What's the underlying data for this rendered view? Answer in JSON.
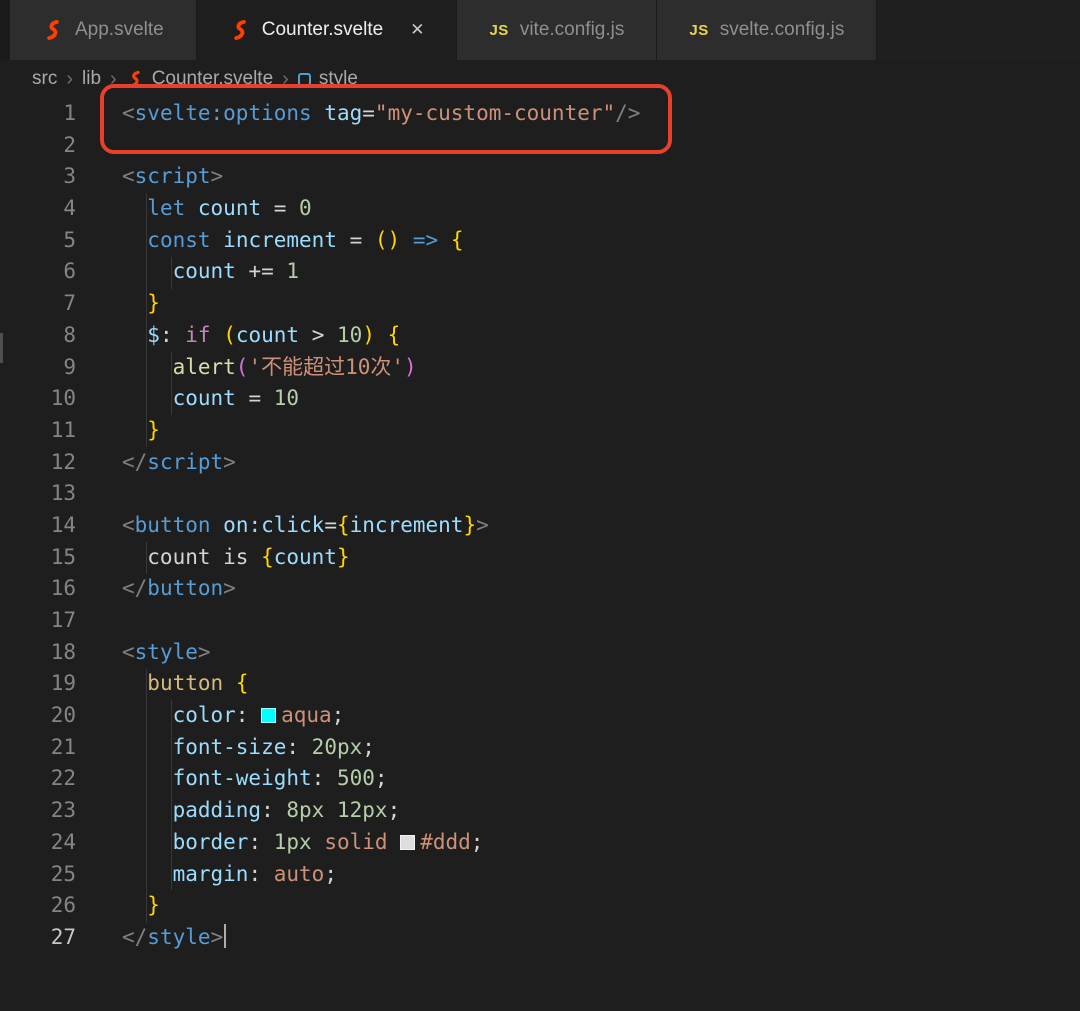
{
  "theme": {
    "editor_bg": "#1e1e1e",
    "tabstrip_bg": "#1f1f1f",
    "tab_inactive_bg": "#2d2d2d",
    "tab_active_bg": "#1e1e1e",
    "tab_inactive_fg": "#8f8f8f",
    "tab_active_fg": "#eeeeee",
    "breadcrumb_fg": "#a9a9a9",
    "line_number_fg": "#858585",
    "line_number_active_fg": "#c6c6c6",
    "svelte_orange": "#ff3e00",
    "js_yellow": "#e8d44d",
    "annotation_red": "#e8402a",
    "tok_tag": "#569cd6",
    "tok_attr": "#9cdcfe",
    "tok_string": "#ce9178",
    "tok_keyword": "#569cd6",
    "tok_control": "#c586c0",
    "tok_variable": "#9cdcfe",
    "tok_number": "#b5cea8",
    "tok_function": "#dcdcaa",
    "tok_punct": "#808080",
    "tok_plain": "#d4d4d4",
    "tok_bracket1": "#ffd700",
    "tok_bracket2": "#da70d6",
    "tok_css_selector": "#d7ba7d"
  },
  "icons": {
    "close": "✕",
    "js_label": "JS"
  },
  "tabs": [
    {
      "label": "App.svelte",
      "icon": "svelte",
      "active": false
    },
    {
      "label": "Counter.svelte",
      "icon": "svelte",
      "active": true
    },
    {
      "label": "vite.config.js",
      "icon": "js",
      "active": false
    },
    {
      "label": "svelte.config.js",
      "icon": "js",
      "active": false
    }
  ],
  "breadcrumb": {
    "separator": "›",
    "items": [
      {
        "label": "src"
      },
      {
        "label": "lib"
      },
      {
        "label": "Counter.svelte",
        "icon": "svelte"
      },
      {
        "label": "style",
        "icon": "symbol"
      }
    ]
  },
  "annotation": {
    "border_color": "#e8402a"
  },
  "editor": {
    "cursor_line": 27,
    "lines": [
      {
        "num": 1,
        "tokens": [
          [
            "p",
            "<"
          ],
          [
            "t",
            "svelte:options"
          ],
          [
            "o",
            " "
          ],
          [
            "a",
            "tag"
          ],
          [
            "o",
            "="
          ],
          [
            "s",
            "\"my-custom-counter\""
          ],
          [
            "p",
            "/>"
          ]
        ]
      },
      {
        "num": 2,
        "tokens": []
      },
      {
        "num": 3,
        "tokens": [
          [
            "p",
            "<"
          ],
          [
            "t",
            "script"
          ],
          [
            "p",
            ">"
          ]
        ]
      },
      {
        "num": 4,
        "tokens": [
          [
            "o",
            "  "
          ],
          [
            "k",
            "let"
          ],
          [
            "o",
            " "
          ],
          [
            "v",
            "count"
          ],
          [
            "o",
            " = "
          ],
          [
            "n",
            "0"
          ]
        ]
      },
      {
        "num": 5,
        "tokens": [
          [
            "o",
            "  "
          ],
          [
            "k",
            "const"
          ],
          [
            "o",
            " "
          ],
          [
            "v",
            "increment"
          ],
          [
            "o",
            " = "
          ],
          [
            "b1",
            "()"
          ],
          [
            "o",
            " "
          ],
          [
            "k",
            "=>"
          ],
          [
            "o",
            " "
          ],
          [
            "b1",
            "{"
          ]
        ]
      },
      {
        "num": 6,
        "tokens": [
          [
            "o",
            "    "
          ],
          [
            "v",
            "count"
          ],
          [
            "o",
            " += "
          ],
          [
            "n",
            "1"
          ]
        ]
      },
      {
        "num": 7,
        "tokens": [
          [
            "o",
            "  "
          ],
          [
            "b1",
            "}"
          ]
        ]
      },
      {
        "num": 8,
        "tokens": [
          [
            "o",
            "  "
          ],
          [
            "v",
            "$"
          ],
          [
            "o",
            ": "
          ],
          [
            "c",
            "if"
          ],
          [
            "o",
            " "
          ],
          [
            "b1",
            "("
          ],
          [
            "v",
            "count"
          ],
          [
            "o",
            " > "
          ],
          [
            "n",
            "10"
          ],
          [
            "b1",
            ")"
          ],
          [
            "o",
            " "
          ],
          [
            "b1",
            "{"
          ]
        ]
      },
      {
        "num": 9,
        "tokens": [
          [
            "o",
            "    "
          ],
          [
            "f",
            "alert"
          ],
          [
            "b2",
            "("
          ],
          [
            "s",
            "'不能超过10次'"
          ],
          [
            "b2",
            ")"
          ]
        ]
      },
      {
        "num": 10,
        "tokens": [
          [
            "o",
            "    "
          ],
          [
            "v",
            "count"
          ],
          [
            "o",
            " = "
          ],
          [
            "n",
            "10"
          ]
        ]
      },
      {
        "num": 11,
        "tokens": [
          [
            "o",
            "  "
          ],
          [
            "b1",
            "}"
          ]
        ]
      },
      {
        "num": 12,
        "tokens": [
          [
            "p",
            "</"
          ],
          [
            "t",
            "script"
          ],
          [
            "p",
            ">"
          ]
        ]
      },
      {
        "num": 13,
        "tokens": []
      },
      {
        "num": 14,
        "tokens": [
          [
            "p",
            "<"
          ],
          [
            "t",
            "button"
          ],
          [
            "o",
            " "
          ],
          [
            "a",
            "on:click"
          ],
          [
            "o",
            "="
          ],
          [
            "b1",
            "{"
          ],
          [
            "v",
            "increment"
          ],
          [
            "b1",
            "}"
          ],
          [
            "p",
            ">"
          ]
        ]
      },
      {
        "num": 15,
        "tokens": [
          [
            "o",
            "  count is "
          ],
          [
            "b1",
            "{"
          ],
          [
            "v",
            "count"
          ],
          [
            "b1",
            "}"
          ]
        ]
      },
      {
        "num": 16,
        "tokens": [
          [
            "p",
            "</"
          ],
          [
            "t",
            "button"
          ],
          [
            "p",
            ">"
          ]
        ]
      },
      {
        "num": 17,
        "tokens": []
      },
      {
        "num": 18,
        "tokens": [
          [
            "p",
            "<"
          ],
          [
            "t",
            "style"
          ],
          [
            "p",
            ">"
          ]
        ]
      },
      {
        "num": 19,
        "tokens": [
          [
            "o",
            "  "
          ],
          [
            "sel",
            "button"
          ],
          [
            "o",
            " "
          ],
          [
            "b1",
            "{"
          ]
        ]
      },
      {
        "num": 20,
        "tokens": [
          [
            "o",
            "    "
          ],
          [
            "a",
            "color"
          ],
          [
            "o",
            ": "
          ],
          [
            "sw",
            "#00ffff"
          ],
          [
            "s",
            "aqua"
          ],
          [
            "o",
            ";"
          ]
        ]
      },
      {
        "num": 21,
        "tokens": [
          [
            "o",
            "    "
          ],
          [
            "a",
            "font-size"
          ],
          [
            "o",
            ": "
          ],
          [
            "n",
            "20px"
          ],
          [
            "o",
            ";"
          ]
        ]
      },
      {
        "num": 22,
        "tokens": [
          [
            "o",
            "    "
          ],
          [
            "a",
            "font-weight"
          ],
          [
            "o",
            ": "
          ],
          [
            "n",
            "500"
          ],
          [
            "o",
            ";"
          ]
        ]
      },
      {
        "num": 23,
        "tokens": [
          [
            "o",
            "    "
          ],
          [
            "a",
            "padding"
          ],
          [
            "o",
            ": "
          ],
          [
            "n",
            "8px"
          ],
          [
            "o",
            " "
          ],
          [
            "n",
            "12px"
          ],
          [
            "o",
            ";"
          ]
        ]
      },
      {
        "num": 24,
        "tokens": [
          [
            "o",
            "    "
          ],
          [
            "a",
            "border"
          ],
          [
            "o",
            ": "
          ],
          [
            "n",
            "1px"
          ],
          [
            "o",
            " "
          ],
          [
            "s",
            "solid"
          ],
          [
            "o",
            " "
          ],
          [
            "sw",
            "#dddddd"
          ],
          [
            "s",
            "#ddd"
          ],
          [
            "o",
            ";"
          ]
        ]
      },
      {
        "num": 25,
        "tokens": [
          [
            "o",
            "    "
          ],
          [
            "a",
            "margin"
          ],
          [
            "o",
            ": "
          ],
          [
            "s",
            "auto"
          ],
          [
            "o",
            ";"
          ]
        ]
      },
      {
        "num": 26,
        "tokens": [
          [
            "o",
            "  "
          ],
          [
            "b1",
            "}"
          ]
        ]
      },
      {
        "num": 27,
        "tokens": [
          [
            "p",
            "</"
          ],
          [
            "t",
            "style"
          ],
          [
            "p",
            ">"
          ]
        ]
      }
    ]
  }
}
